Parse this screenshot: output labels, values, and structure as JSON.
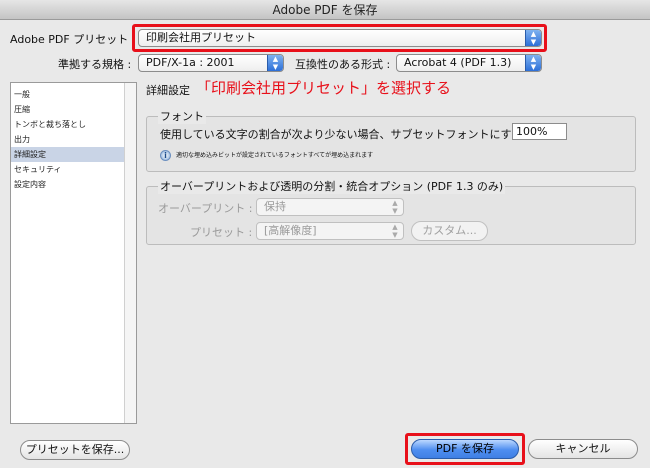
{
  "window": {
    "title": "Adobe PDF を保存"
  },
  "preset": {
    "label": "Adobe PDF プリセット :",
    "value": "印刷会社用プリセット"
  },
  "standard": {
    "label": "準拠する規格 :",
    "value": "PDF/X-1a : 2001"
  },
  "compatibility": {
    "label": "互換性のある形式 :",
    "value": "Acrobat 4 (PDF 1.3)"
  },
  "sidebar": {
    "items": [
      {
        "label": "一般"
      },
      {
        "label": "圧縮"
      },
      {
        "label": "トンボと裁ち落とし"
      },
      {
        "label": "出力"
      },
      {
        "label": "詳細設定"
      },
      {
        "label": "セキュリティ"
      },
      {
        "label": "設定内容"
      }
    ],
    "selected_index": 4
  },
  "panel": {
    "section_title": "詳細設定",
    "annotation": "「印刷会社用プリセット」を選択する",
    "fonts": {
      "title": "フォント",
      "subset_label": "使用している文字の割合が次より少ない場合、サブセットフォントにする :",
      "subset_value": "100%",
      "info_text": "適切な埋め込みビットが設定されているフォントすべてが埋め込まれます"
    },
    "overprint": {
      "title": "オーバープリントおよび透明の分割・統合オプション (PDF 1.3 のみ)",
      "overprint_label": "オーバープリント :",
      "overprint_value": "保持",
      "preset_label": "プリセット :",
      "preset_value": "[高解像度]",
      "custom_label": "カスタム..."
    }
  },
  "footer": {
    "save_preset_label": "プリセットを保存...",
    "save_pdf_label": "PDF を保存",
    "cancel_label": "キャンセル"
  },
  "colors": {
    "highlight": "#e8101a",
    "selection": "#c9d4e6",
    "default_button": "#4e8ef0"
  }
}
